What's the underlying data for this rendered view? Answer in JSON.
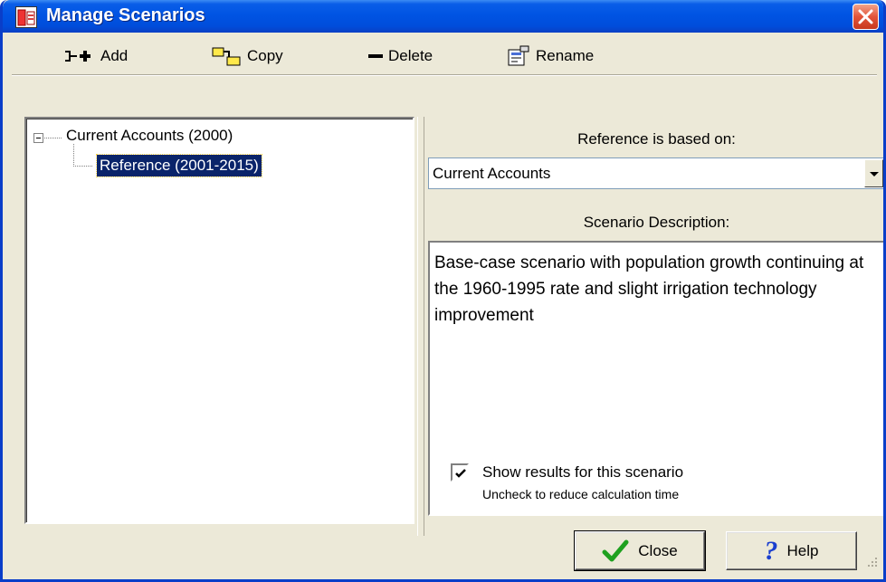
{
  "window": {
    "title": "Manage Scenarios"
  },
  "toolbar": {
    "add_label": "Add",
    "copy_label": "Copy",
    "delete_label": "Delete",
    "rename_label": "Rename"
  },
  "tree": {
    "root_label": "Current Accounts (2000)",
    "child_label": "Reference (2001-2015)"
  },
  "reference": {
    "label": "Reference is based on:",
    "selected": "Current Accounts"
  },
  "description": {
    "label": "Scenario Description:",
    "text": "Base-case scenario with population growth continuing at the 1960-1995 rate and slight irrigation technology improvement"
  },
  "show_results": {
    "label": "Show results for this scenario",
    "hint": "Uncheck to reduce calculation time",
    "checked": true
  },
  "buttons": {
    "close_label": "Close",
    "help_label": "Help"
  },
  "icons": {
    "add": "add-icon",
    "copy": "copy-icon",
    "delete": "delete-icon",
    "rename": "rename-icon",
    "close": "checkmark-icon",
    "help": "question-icon"
  },
  "colors": {
    "titlebar": "#0054e3",
    "selection": "#0a246a",
    "window_bg": "#ece9d8"
  }
}
